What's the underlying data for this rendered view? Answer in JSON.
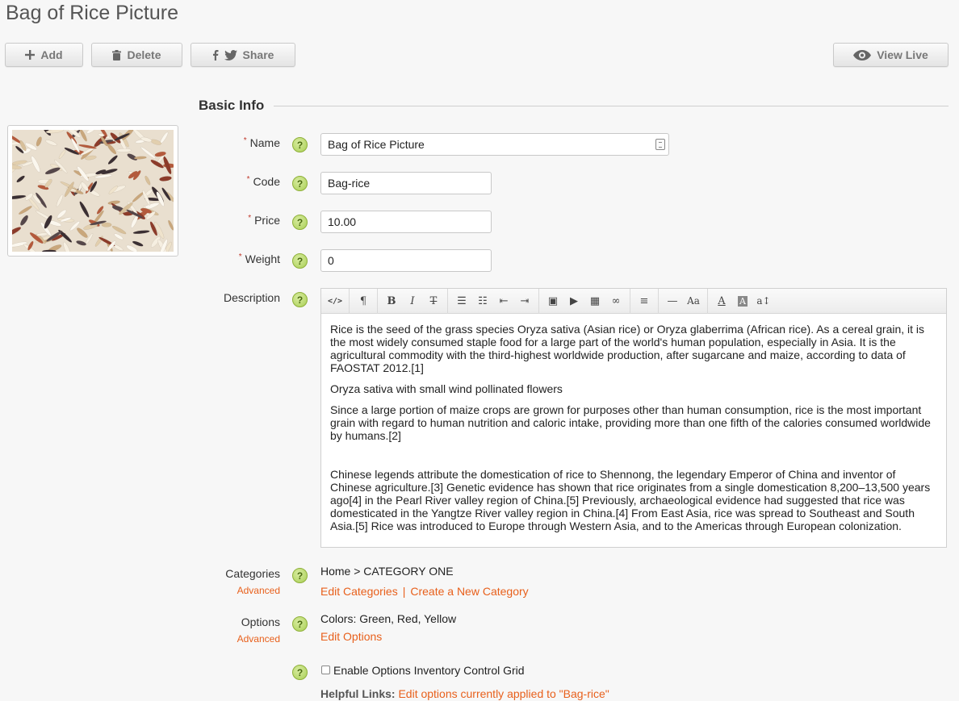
{
  "page": {
    "title": "Bag of Rice Picture"
  },
  "toolbar": {
    "add_label": "Add",
    "delete_label": "Delete",
    "share_label": "Share",
    "view_live_label": "View Live"
  },
  "section": {
    "heading": "Basic Info"
  },
  "image": {
    "alt": "bag of rice picture",
    "icon": "rice-grains-photo"
  },
  "fields": {
    "name": {
      "label": "Name",
      "value": "Bag of Rice Picture",
      "required": true
    },
    "code": {
      "label": "Code",
      "value": "Bag-rice",
      "required": true
    },
    "price": {
      "label": "Price",
      "value": "10.00",
      "required": true
    },
    "weight": {
      "label": "Weight",
      "value": "0",
      "required": true
    },
    "required_marker": "*"
  },
  "description": {
    "label": "Description",
    "toolbar": [
      "code-view",
      "paragraph-format",
      "bold",
      "italic",
      "strikethrough",
      "unordered-list",
      "ordered-list",
      "outdent",
      "indent",
      "insert-image",
      "insert-video",
      "insert-table",
      "insert-link",
      "align",
      "horizontal-rule",
      "font-size",
      "font-color",
      "background-color",
      "line-height"
    ],
    "paragraphs": [
      "Rice is the seed of the grass species Oryza sativa (Asian rice) or Oryza glaberrima (African rice). As a cereal grain, it is the most widely consumed staple food for a large part of the world's human population, especially in Asia. It is the agricultural commodity with the third-highest worldwide production, after sugarcane and maize, according to data of FAOSTAT 2012.[1]",
      "Oryza sativa with small wind pollinated flowers",
      "Since a large portion of maize crops are grown for purposes other than human consumption, rice is the most important grain with regard to human nutrition and caloric intake, providing more than one fifth of the calories consumed worldwide by humans.[2]",
      "Chinese legends attribute the domestication of rice to Shennong, the legendary Emperor of China and inventor of Chinese agriculture.[3] Genetic evidence has shown that rice originates from a single domestication 8,200–13,500 years ago[4] in the Pearl River valley region of China.[5] Previously, archaeological evidence had suggested that rice was domesticated in the Yangtze River valley region in China.[4] From East Asia, rice was spread to Southeast and South Asia.[5] Rice was introduced to Europe through Western Asia, and to the Americas through European colonization."
    ]
  },
  "categories": {
    "label": "Categories",
    "advanced_label": "Advanced",
    "value": "Home > CATEGORY ONE",
    "edit_link": "Edit Categories",
    "separator": "|",
    "create_link": "Create a New Category"
  },
  "options": {
    "label": "Options",
    "advanced_label": "Advanced",
    "value": "Colors: Green, Red, Yellow",
    "edit_link": "Edit Options"
  },
  "inventory": {
    "checkbox_label": "Enable Options Inventory Control Grid",
    "checked": false,
    "helpful_label": "Helpful Links:",
    "helpful_link": "Edit options currently applied to \"Bag-rice\""
  },
  "help_icon_text": "?",
  "colors": {
    "accent": "#e8601c",
    "help_icon": "#a9cf55",
    "required": "#c0392b"
  }
}
